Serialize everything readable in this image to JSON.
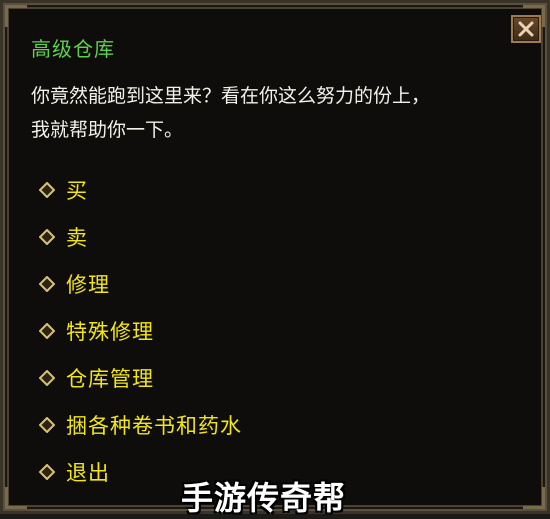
{
  "dialog": {
    "title": "高级仓库",
    "close_icon": "close-x-icon",
    "message_line1": "你竟然能跑到这里来？看在你这么努力的份上，",
    "message_line2": "我就帮助你一下。"
  },
  "menu": {
    "bullet_icon": "diamond-bullet-icon",
    "items": [
      {
        "label": "买"
      },
      {
        "label": "卖"
      },
      {
        "label": "修理"
      },
      {
        "label": "特殊修理"
      },
      {
        "label": "仓库管理"
      },
      {
        "label": "捆各种卷书和药水"
      },
      {
        "label": "退出"
      }
    ]
  },
  "watermark": "手游传奇帮",
  "colors": {
    "title": "#5fcf4e",
    "menu_text": "#f2e614",
    "message_text": "#f1f1ea",
    "background": "#0e0d0b"
  }
}
